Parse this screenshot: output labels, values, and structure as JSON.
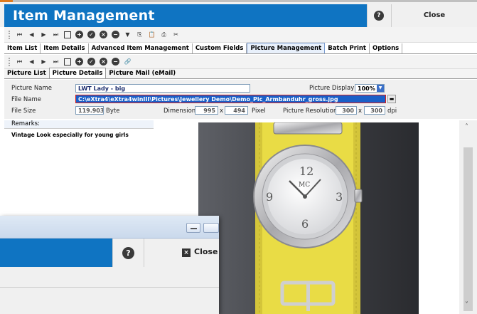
{
  "window": {
    "title": "Item Management",
    "help_glyph": "?",
    "close_label": "Close"
  },
  "tabs_main": [
    "Item List",
    "Item Details",
    "Advanced Item Management",
    "Custom Fields",
    "Picture Management",
    "Batch Print",
    "Options"
  ],
  "tabs_main_active": "Picture Management",
  "tabs_sub": [
    "Picture List",
    "Picture Details",
    "Picture Mail (eMail)"
  ],
  "tabs_sub_active": "Picture Details",
  "form": {
    "picture_name_label": "Picture Name",
    "picture_name_value": "LWT Lady - big",
    "picture_display_label": "Picture Display",
    "picture_display_value": "100%",
    "file_name_label": "File Name",
    "file_name_value": "C:\\eXtra4\\eXtra4winIII\\Pictures\\Jewellery Demo\\Demo_Pic_Armbanduhr_gross.jpg",
    "file_size_label": "File Size",
    "file_size_value": "119.903",
    "file_size_unit": "Byte",
    "dimension_label": "Dimension",
    "dimension_w": "995",
    "dimension_x": "x",
    "dimension_h": "494",
    "dimension_unit": "Pixel",
    "resolution_label": "Picture Resolution",
    "resolution_w": "300",
    "resolution_x": "x",
    "resolution_h": "300",
    "resolution_unit": "dpi"
  },
  "remarks": {
    "label": "Remarks:",
    "text": "Vintage Look especially for young girls"
  },
  "overlay": {
    "help_glyph": "?",
    "close_label": "Close"
  },
  "colors": {
    "title_blue": "#0f74c2",
    "accent_orange": "#e07a1e",
    "watch_strap": "#e9dc45"
  }
}
